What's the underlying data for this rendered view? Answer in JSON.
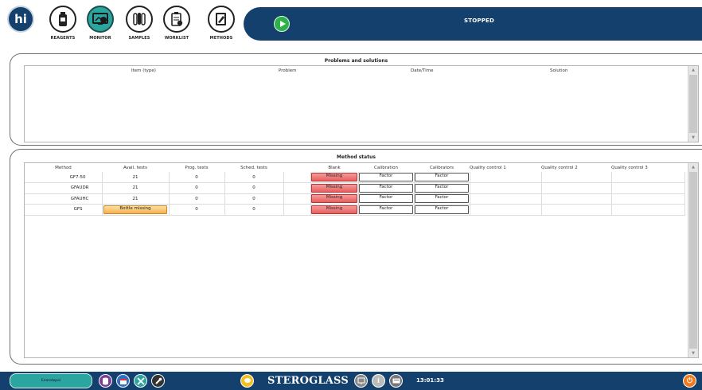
{
  "app": {
    "logo_text": "hi"
  },
  "toolbar": {
    "items": [
      {
        "label": "REAGENTS",
        "icon": "reagent-bottle-icon"
      },
      {
        "label": "MONITOR",
        "icon": "monitor-icon",
        "active": true
      },
      {
        "label": "SAMPLES",
        "icon": "test-tubes-icon"
      },
      {
        "label": "WORKLIST",
        "icon": "worklist-icon"
      },
      {
        "label": "METHODS",
        "icon": "methods-icon"
      }
    ]
  },
  "status": {
    "text": "STOPPED",
    "play_icon": "play-icon"
  },
  "problems_panel": {
    "title": "Problems and solutions",
    "columns": [
      "Item (type)",
      "Problem",
      "Date/Time",
      "Solution"
    ],
    "rows": []
  },
  "method_status_panel": {
    "title": "Method status",
    "columns": [
      "Method",
      "Avail. tests",
      "Prog. tests",
      "Sched. tests",
      "",
      "Blank",
      "Calibration",
      "Calibrators",
      "Quality control 1",
      "Quality control 2",
      "Quality control 3"
    ],
    "rows": [
      {
        "method": "GF7-50",
        "avail": "21",
        "prog": "0",
        "sched": "0",
        "blank": "Missing",
        "calibration": "Factor",
        "calibrators": "Factor",
        "qc1": "",
        "qc2": "",
        "qc3": ""
      },
      {
        "method": "GFAUDR",
        "avail": "21",
        "prog": "0",
        "sched": "0",
        "blank": "Missing",
        "calibration": "Factor",
        "calibrators": "Factor",
        "qc1": "",
        "qc2": "",
        "qc3": ""
      },
      {
        "method": "GFAUHC",
        "avail": "21",
        "prog": "0",
        "sched": "0",
        "blank": "Missing",
        "calibration": "Factor",
        "calibrators": "Factor",
        "qc1": "",
        "qc2": "",
        "qc3": ""
      },
      {
        "method": "GFS",
        "avail": "Bottle missing",
        "avail_warning": true,
        "prog": "0",
        "sched": "0",
        "blank": "Missing",
        "calibration": "Factor",
        "calibrators": "Factor",
        "qc1": "",
        "qc2": "",
        "qc3": ""
      }
    ]
  },
  "bottom": {
    "user_label": "Enorotopol",
    "icons": [
      "database-icon",
      "calendar-icon",
      "tools-icon",
      "wrench-icon",
      "message-icon"
    ],
    "brand": "STEROGLASS",
    "status_icons": [
      "network-icon",
      "info-icon",
      "keyboard-icon"
    ],
    "time": "13:01:33",
    "power_icon": "power-icon"
  },
  "colors": {
    "navy": "#14406e",
    "teal": "#2ba5a0",
    "missing_red": "#e85e5e",
    "warning_orange": "#f6b14a",
    "power_orange": "#f07a1c",
    "play_green": "#2db24a"
  }
}
